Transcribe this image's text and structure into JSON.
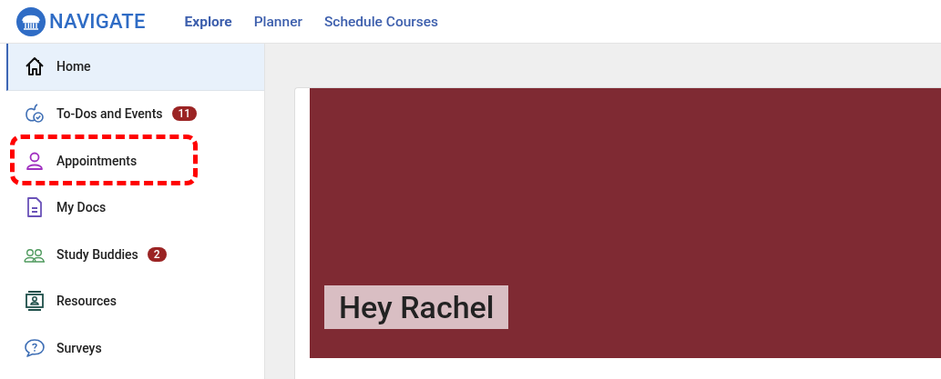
{
  "header": {
    "brand": "NAVIGATE",
    "links": [
      {
        "label": "Explore",
        "selected": true
      },
      {
        "label": "Planner",
        "selected": false
      },
      {
        "label": "Schedule Courses",
        "selected": false
      }
    ]
  },
  "sidebar": {
    "items": [
      {
        "kind": "home",
        "label": "Home",
        "selected": true,
        "highlighted": false
      },
      {
        "kind": "todos",
        "label": "To-Dos and Events",
        "badge": "11",
        "selected": false,
        "highlighted": false
      },
      {
        "kind": "appointments",
        "label": "Appointments",
        "selected": false,
        "highlighted": true
      },
      {
        "kind": "docs",
        "label": "My Docs",
        "selected": false,
        "highlighted": false
      },
      {
        "kind": "buddies",
        "label": "Study Buddies",
        "badge": "2",
        "selected": false,
        "highlighted": false
      },
      {
        "kind": "resources",
        "label": "Resources",
        "selected": false,
        "highlighted": false
      },
      {
        "kind": "surveys",
        "label": "Surveys",
        "selected": false,
        "highlighted": false
      }
    ]
  },
  "banner": {
    "greeting": "Hey Rachel"
  }
}
